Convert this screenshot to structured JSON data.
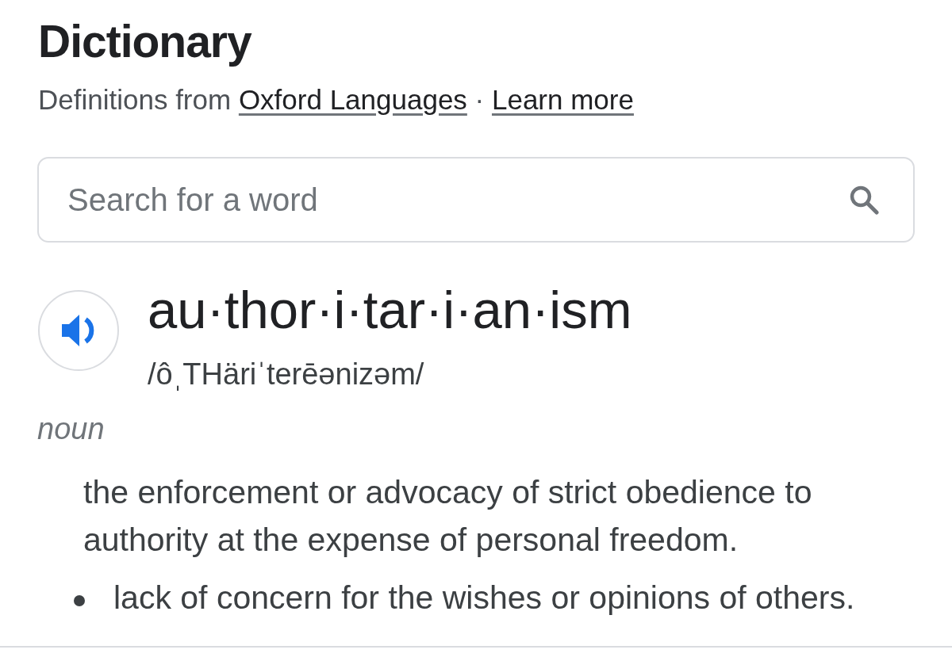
{
  "header": {
    "title": "Dictionary",
    "source_prefix": "Definitions from",
    "source_link": "Oxford Languages",
    "separator": "·",
    "learn_more": "Learn more"
  },
  "search": {
    "placeholder": "Search for a word"
  },
  "entry": {
    "word": "au·thor·i·tar·i·an·ism",
    "pronunciation": "/ôˌTHäriˈterēənizəm/",
    "part_of_speech": "noun",
    "senses": [
      {
        "kind": "definition",
        "text": "the enforcement or advocacy of strict obedience to authority at the expense of personal freedom."
      },
      {
        "kind": "subsense",
        "text": "lack of concern for the wishes or opinions of others."
      }
    ]
  }
}
